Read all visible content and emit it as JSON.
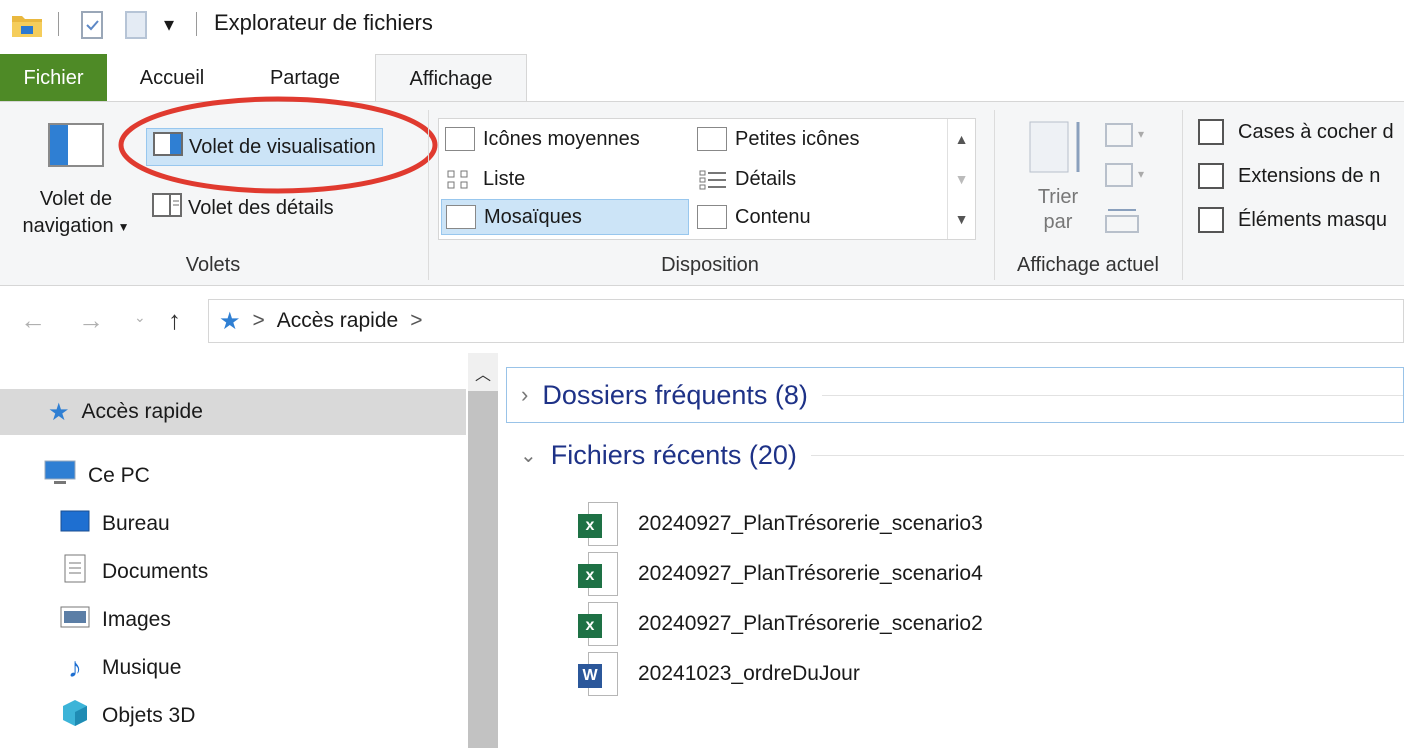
{
  "window": {
    "title": "Explorateur de fichiers",
    "qa_dropdown_glyph": "▾"
  },
  "tabs": [
    {
      "label": "Fichier"
    },
    {
      "label": "Accueil"
    },
    {
      "label": "Partage"
    },
    {
      "label": "Affichage"
    }
  ],
  "ribbon": {
    "volets": {
      "nav_pane_line1": "Volet de",
      "nav_pane_line2": "navigation",
      "preview_pane": "Volet de visualisation",
      "details_pane": "Volet des détails",
      "group_label": "Volets"
    },
    "disposition": {
      "items": [
        "Icônes moyennes",
        "Petites icônes",
        "Liste",
        "Détails",
        "Mosaïques",
        "Contenu"
      ],
      "selected": "Mosaïques",
      "group_label": "Disposition"
    },
    "affichage_actuel": {
      "sort_line1": "Trier",
      "sort_line2": "par",
      "group_label": "Affichage actuel"
    },
    "checkboxes": [
      {
        "label": "Cases à cocher d",
        "checked": false
      },
      {
        "label": "Extensions de n",
        "checked": false
      },
      {
        "label": "Éléments masqu",
        "checked": false
      }
    ]
  },
  "address": {
    "crumbs": [
      "Accès rapide"
    ],
    "separator": ">"
  },
  "nav_pane": {
    "items": [
      {
        "label": "Accès rapide",
        "icon": "star-icon",
        "selected": true
      },
      {
        "label": "Ce PC",
        "icon": "computer-icon"
      },
      {
        "label": "Bureau",
        "icon": "desktop-icon"
      },
      {
        "label": "Documents",
        "icon": "documents-icon"
      },
      {
        "label": "Images",
        "icon": "pictures-icon"
      },
      {
        "label": "Musique",
        "icon": "music-icon"
      },
      {
        "label": "Objets 3D",
        "icon": "objects-3d-icon"
      }
    ]
  },
  "content": {
    "groups": [
      {
        "label": "Dossiers fréquents (8)",
        "expanded": false
      },
      {
        "label": "Fichiers récents (20)",
        "expanded": true
      }
    ],
    "files": [
      {
        "name": "20240927_PlanTrésorerie_scenario3",
        "type": "excel"
      },
      {
        "name": "20240927_PlanTrésorerie_scenario4",
        "type": "excel"
      },
      {
        "name": "20240927_PlanTrésorerie_scenario2",
        "type": "excel"
      },
      {
        "name": "20241023_ordreDuJour",
        "type": "word"
      }
    ]
  },
  "colors": {
    "file_tab": "#4e8a26",
    "excel": "#1e7145",
    "word": "#2b579a",
    "highlight": "#cce4f7",
    "annotation": "#e03a2f",
    "group_text": "#1e3287"
  }
}
